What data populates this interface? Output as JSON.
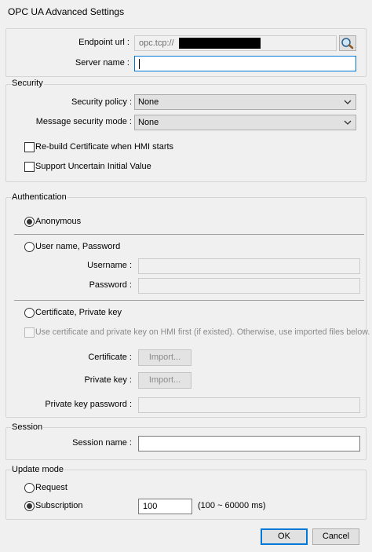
{
  "window": {
    "title": "OPC UA Advanced Settings"
  },
  "endpoint": {
    "endpoint_label": "Endpoint url :",
    "endpoint_value": "opc.tcp://",
    "server_name_label": "Server name :",
    "server_name_value": ""
  },
  "security": {
    "group_label": "Security",
    "policy_label": "Security policy :",
    "policy_value": "None",
    "mode_label": "Message security mode :",
    "mode_value": "None",
    "rebuild_cert_label": "Re-build Certificate when HMI starts",
    "uncertain_label": "Support Uncertain Initial Value"
  },
  "authentication": {
    "group_label": "Authentication",
    "anonymous_label": "Anonymous",
    "userpass_label": "User name, Password",
    "username_label": "Username :",
    "password_label": "Password :",
    "cert_label": "Certificate, Private key",
    "use_cert_first_label": "Use certificate and private key on HMI first (if existed). Otherwise, use imported files below.",
    "certificate_label": "Certificate :",
    "private_key_label": "Private key :",
    "import_label": "Import...",
    "pk_password_label": "Private key password :"
  },
  "session": {
    "group_label": "Session",
    "name_label": "Session name :",
    "name_value": ""
  },
  "update_mode": {
    "group_label": "Update mode",
    "request_label": "Request",
    "subscription_label": "Subscription",
    "interval_value": "100",
    "range_hint": "(100 ~ 60000 ms)"
  },
  "footer": {
    "ok_label": "OK",
    "cancel_label": "Cancel"
  },
  "colors": {
    "accent": "#0078d7",
    "panel": "#f0f0f0"
  },
  "icons": {
    "search": "magnifier-icon",
    "dropdown": "chevron-down-icon"
  }
}
